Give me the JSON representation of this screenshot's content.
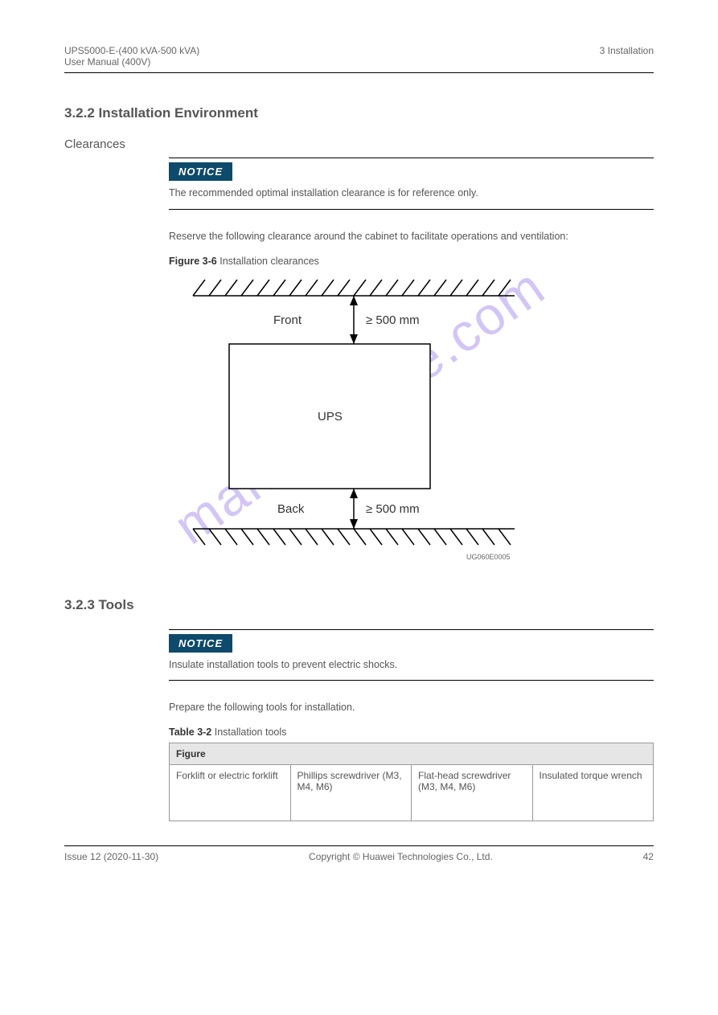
{
  "header": {
    "left_line1": "UPS5000-E-(400 kVA-500 kVA)",
    "left_line2": "User Manual (400V)",
    "right": "3 Installation"
  },
  "section_heading": "3.2.2 Installation Environment",
  "clearances": {
    "label": "Clearances",
    "notice_badge": "NOTICE",
    "notice_text": "The recommended optimal installation clearance is for reference only.",
    "paragraph": "Reserve the following clearance around the cabinet to facilitate operations and ventilation:",
    "figure_label_bold": "Figure 3-6",
    "figure_label_text": " Installation clearances",
    "diagram": {
      "front": "Front",
      "back": "Back",
      "front_dim": "≥ 500 mm",
      "back_dim": "≥ 500 mm",
      "center": "UPS",
      "code": "UG060E0005"
    }
  },
  "tools": {
    "heading": "3.2.3 Tools",
    "notice_badge": "NOTICE",
    "notice_text": "Insulate installation tools to prevent electric shocks.",
    "paragraph": "Prepare the following tools for installation.",
    "table_label_bold": "Table 3-2",
    "table_label_text": " Installation tools",
    "table": {
      "header": "Figure",
      "cells": [
        "Forklift or electric forklift",
        "Phillips screwdriver (M3, M4, M6)",
        "Flat-head screwdriver (M3, M4, M6)",
        "Insulated torque wrench"
      ]
    }
  },
  "footer": {
    "left": "Issue 12 (2020-11-30)",
    "center": "Copyright © Huawei Technologies Co., Ltd.",
    "right": "42"
  },
  "watermark": "manualshive.com"
}
